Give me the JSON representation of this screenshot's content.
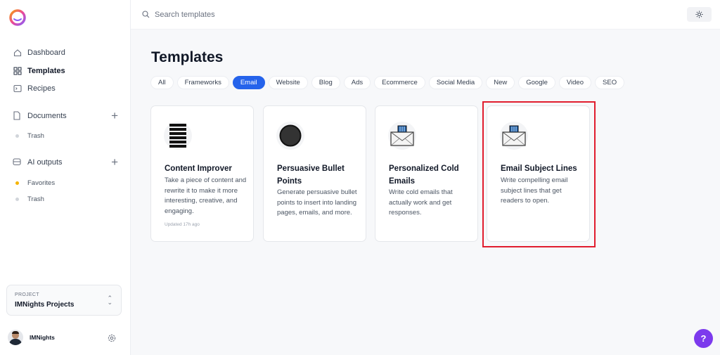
{
  "search": {
    "placeholder": "Search templates"
  },
  "sidebar": {
    "nav": [
      {
        "label": "Dashboard",
        "icon": "home-icon"
      },
      {
        "label": "Templates",
        "icon": "grid-icon",
        "active": true
      },
      {
        "label": "Recipes",
        "icon": "terminal-icon"
      }
    ],
    "documents": {
      "label": "Documents",
      "items": [
        "Trash"
      ]
    },
    "ai_outputs": {
      "label": "AI outputs",
      "items": [
        "Favorites",
        "Trash"
      ]
    },
    "project": {
      "label": "PROJECT",
      "name": "IMNights Projects"
    },
    "user": {
      "name": "IMNights"
    }
  },
  "main": {
    "title": "Templates",
    "tabs": [
      "All",
      "Frameworks",
      "Email",
      "Website",
      "Blog",
      "Ads",
      "Ecommerce",
      "Social Media",
      "New",
      "Google",
      "Video",
      "SEO"
    ],
    "active_tab": "Email",
    "cards": [
      {
        "title": "Content Improver",
        "description": "Take a piece of content and rewrite it to make it more interesting, creative, and engaging.",
        "updated": "Updated 17h ago",
        "icon": "list-icon"
      },
      {
        "title": "Persuasive Bullet Points",
        "description": "Generate persuasive bullet points to insert into landing pages, emails, and more.",
        "icon": "black-circle-icon"
      },
      {
        "title": "Personalized Cold Emails",
        "description": "Write cold emails that actually work and get responses.",
        "icon": "mailbox-icon"
      },
      {
        "title": "Email Subject Lines",
        "description": "Write compelling email subject lines that get readers to open.",
        "icon": "mailbox-icon"
      }
    ]
  },
  "help": {
    "label": "?"
  },
  "colors": {
    "accent": "#2563eb",
    "highlight": "#e11d2e",
    "help": "#7c3aed"
  }
}
